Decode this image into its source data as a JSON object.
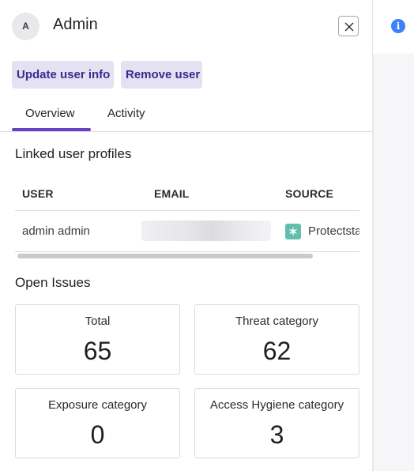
{
  "header": {
    "avatar_initial": "A",
    "title": "Admin",
    "close_icon": "close-icon"
  },
  "info_icon": "i",
  "actions": {
    "update_label": "Update user info",
    "remove_label": "Remove user"
  },
  "tabs": [
    {
      "label": "Overview",
      "active": true
    },
    {
      "label": "Activity",
      "active": false
    }
  ],
  "linked_profiles": {
    "title": "Linked user profiles",
    "columns": [
      "USER",
      "EMAIL",
      "SOURCE"
    ],
    "rows": [
      {
        "user": "admin admin",
        "email": "",
        "source": "Protectsta",
        "source_icon": "✶"
      }
    ]
  },
  "open_issues": {
    "title": "Open Issues",
    "cards": [
      {
        "label": "Total",
        "value": "65"
      },
      {
        "label": "Threat category",
        "value": "62"
      },
      {
        "label": "Exposure category",
        "value": "0"
      },
      {
        "label": "Access Hygiene category",
        "value": "3"
      }
    ]
  },
  "colors": {
    "accent": "#6a40c9",
    "button_bg": "#e4e1f3",
    "button_text": "#3a2a8c",
    "info": "#3b82f6",
    "source_icon": "#5fbfac"
  }
}
